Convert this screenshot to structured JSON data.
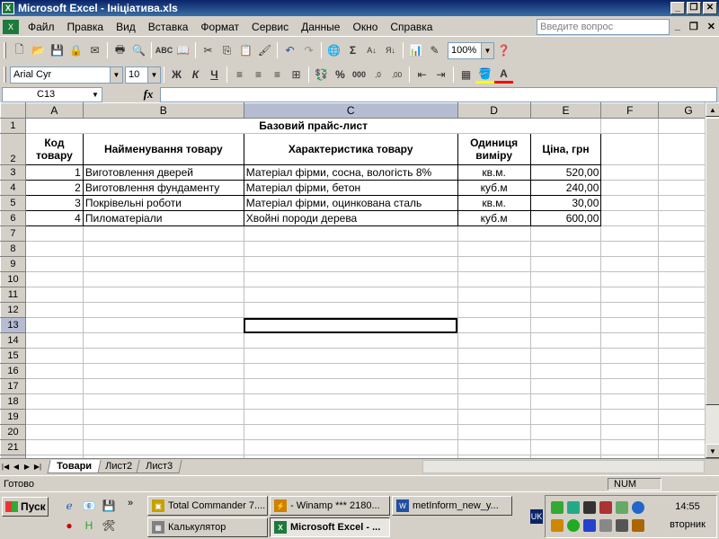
{
  "window": {
    "title": "Microsoft Excel - Ініціатива.xls"
  },
  "menu": {
    "items": [
      "Файл",
      "Правка",
      "Вид",
      "Вставка",
      "Формат",
      "Сервис",
      "Данные",
      "Окно",
      "Справка"
    ],
    "ask_placeholder": "Введите вопрос"
  },
  "toolbar": {
    "zoom": "100%",
    "font": "Arial Cyr",
    "size": "10",
    "bold": "Ж",
    "italic": "К",
    "underline": "Ч",
    "percent": "%",
    "thousands": "000"
  },
  "formula": {
    "cell_ref": "C13",
    "fx": "fx",
    "content": ""
  },
  "columns": [
    "A",
    "B",
    "C",
    "D",
    "E",
    "F",
    "G"
  ],
  "sheet": {
    "title": "Базовий прайс-лист",
    "headers": {
      "code": "Код товару",
      "name": "Найменування товару",
      "desc": "Характеристика товару",
      "unit": "Одиниця виміру",
      "price": "Ціна, грн"
    },
    "rows": [
      {
        "code": "1",
        "name": "Виготовлення дверей",
        "desc": "Матеріал фірми, сосна, вологість 8%",
        "unit": "кв.м.",
        "price": "520,00"
      },
      {
        "code": "2",
        "name": "Виготовлення фундаменту",
        "desc": "Матеріал фірми, бетон",
        "unit": "куб.м",
        "price": "240,00"
      },
      {
        "code": "3",
        "name": "Покрівельні роботи",
        "desc": "Матеріал фірми, оцинкована сталь",
        "unit": "кв.м.",
        "price": "30,00"
      },
      {
        "code": "4",
        "name": "Пиломатеріали",
        "desc": "Хвойні породи дерева",
        "unit": "куб.м",
        "price": "600,00"
      }
    ]
  },
  "tabs": [
    "Товари",
    "Лист2",
    "Лист3"
  ],
  "status": {
    "ready": "Готово",
    "num": "NUM"
  },
  "taskbar": {
    "start": "Пуск",
    "tasks": [
      "Total Commander 7....",
      "- Winamp *** 2180...",
      "metInform_new_y...",
      "Калькулятор",
      "Microsoft Excel - ..."
    ],
    "lang": "UK",
    "time": "14:55",
    "day": "вторник"
  }
}
